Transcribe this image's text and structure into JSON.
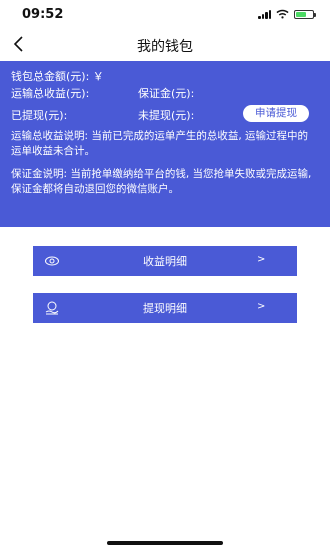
{
  "status_bar": {
    "time": "09:52"
  },
  "nav": {
    "title": "我的钱包"
  },
  "wallet": {
    "balance_label": "钱包总金额(元): ￥",
    "income_label": "运输总收益(元):",
    "deposit_label": "保证金(元):",
    "withdrawn_label": "已提现(元):",
    "not_withdrawn_label": "未提现(元):",
    "withdraw_button": "申请提现",
    "income_desc": "运输总收益说明: 当前已完成的运单产生的总收益, 运输过程中的运单收益未合计。",
    "deposit_desc": "保证金说明: 当前抢单缴纳给平台的钱, 当您抢单失败或完成运输, 保证金都将自动退回您的微信账户。"
  },
  "menu": {
    "items": [
      {
        "label": "收益明细",
        "arrow": ">",
        "icon": "money-eye-icon"
      },
      {
        "label": "提现明细",
        "arrow": ">",
        "icon": "coin-hand-icon"
      }
    ]
  },
  "colors": {
    "primary": "#4a5ad6",
    "background": "#ffffff"
  }
}
